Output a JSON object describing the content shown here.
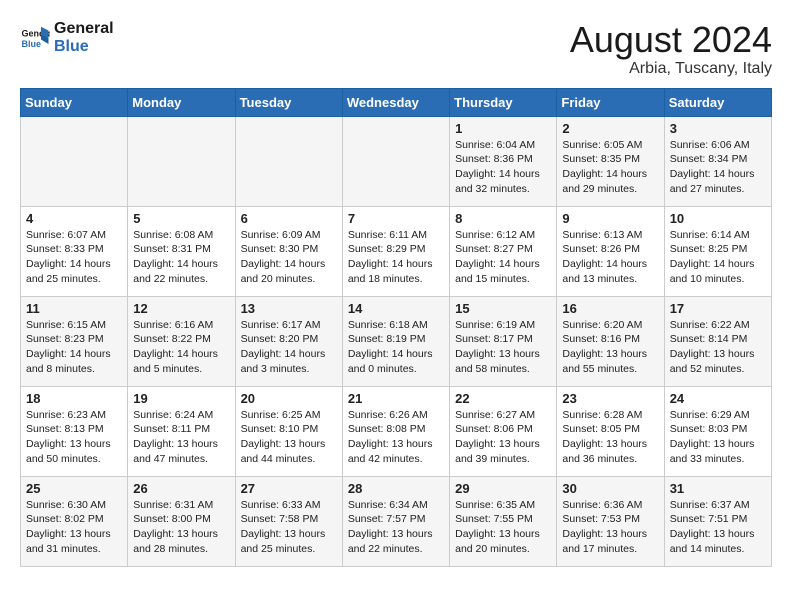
{
  "header": {
    "logo_line1": "General",
    "logo_line2": "Blue",
    "month_year": "August 2024",
    "location": "Arbia, Tuscany, Italy"
  },
  "weekdays": [
    "Sunday",
    "Monday",
    "Tuesday",
    "Wednesday",
    "Thursday",
    "Friday",
    "Saturday"
  ],
  "weeks": [
    [
      {
        "day": "",
        "info": ""
      },
      {
        "day": "",
        "info": ""
      },
      {
        "day": "",
        "info": ""
      },
      {
        "day": "",
        "info": ""
      },
      {
        "day": "1",
        "info": "Sunrise: 6:04 AM\nSunset: 8:36 PM\nDaylight: 14 hours\nand 32 minutes."
      },
      {
        "day": "2",
        "info": "Sunrise: 6:05 AM\nSunset: 8:35 PM\nDaylight: 14 hours\nand 29 minutes."
      },
      {
        "day": "3",
        "info": "Sunrise: 6:06 AM\nSunset: 8:34 PM\nDaylight: 14 hours\nand 27 minutes."
      }
    ],
    [
      {
        "day": "4",
        "info": "Sunrise: 6:07 AM\nSunset: 8:33 PM\nDaylight: 14 hours\nand 25 minutes."
      },
      {
        "day": "5",
        "info": "Sunrise: 6:08 AM\nSunset: 8:31 PM\nDaylight: 14 hours\nand 22 minutes."
      },
      {
        "day": "6",
        "info": "Sunrise: 6:09 AM\nSunset: 8:30 PM\nDaylight: 14 hours\nand 20 minutes."
      },
      {
        "day": "7",
        "info": "Sunrise: 6:11 AM\nSunset: 8:29 PM\nDaylight: 14 hours\nand 18 minutes."
      },
      {
        "day": "8",
        "info": "Sunrise: 6:12 AM\nSunset: 8:27 PM\nDaylight: 14 hours\nand 15 minutes."
      },
      {
        "day": "9",
        "info": "Sunrise: 6:13 AM\nSunset: 8:26 PM\nDaylight: 14 hours\nand 13 minutes."
      },
      {
        "day": "10",
        "info": "Sunrise: 6:14 AM\nSunset: 8:25 PM\nDaylight: 14 hours\nand 10 minutes."
      }
    ],
    [
      {
        "day": "11",
        "info": "Sunrise: 6:15 AM\nSunset: 8:23 PM\nDaylight: 14 hours\nand 8 minutes."
      },
      {
        "day": "12",
        "info": "Sunrise: 6:16 AM\nSunset: 8:22 PM\nDaylight: 14 hours\nand 5 minutes."
      },
      {
        "day": "13",
        "info": "Sunrise: 6:17 AM\nSunset: 8:20 PM\nDaylight: 14 hours\nand 3 minutes."
      },
      {
        "day": "14",
        "info": "Sunrise: 6:18 AM\nSunset: 8:19 PM\nDaylight: 14 hours\nand 0 minutes."
      },
      {
        "day": "15",
        "info": "Sunrise: 6:19 AM\nSunset: 8:17 PM\nDaylight: 13 hours\nand 58 minutes."
      },
      {
        "day": "16",
        "info": "Sunrise: 6:20 AM\nSunset: 8:16 PM\nDaylight: 13 hours\nand 55 minutes."
      },
      {
        "day": "17",
        "info": "Sunrise: 6:22 AM\nSunset: 8:14 PM\nDaylight: 13 hours\nand 52 minutes."
      }
    ],
    [
      {
        "day": "18",
        "info": "Sunrise: 6:23 AM\nSunset: 8:13 PM\nDaylight: 13 hours\nand 50 minutes."
      },
      {
        "day": "19",
        "info": "Sunrise: 6:24 AM\nSunset: 8:11 PM\nDaylight: 13 hours\nand 47 minutes."
      },
      {
        "day": "20",
        "info": "Sunrise: 6:25 AM\nSunset: 8:10 PM\nDaylight: 13 hours\nand 44 minutes."
      },
      {
        "day": "21",
        "info": "Sunrise: 6:26 AM\nSunset: 8:08 PM\nDaylight: 13 hours\nand 42 minutes."
      },
      {
        "day": "22",
        "info": "Sunrise: 6:27 AM\nSunset: 8:06 PM\nDaylight: 13 hours\nand 39 minutes."
      },
      {
        "day": "23",
        "info": "Sunrise: 6:28 AM\nSunset: 8:05 PM\nDaylight: 13 hours\nand 36 minutes."
      },
      {
        "day": "24",
        "info": "Sunrise: 6:29 AM\nSunset: 8:03 PM\nDaylight: 13 hours\nand 33 minutes."
      }
    ],
    [
      {
        "day": "25",
        "info": "Sunrise: 6:30 AM\nSunset: 8:02 PM\nDaylight: 13 hours\nand 31 minutes."
      },
      {
        "day": "26",
        "info": "Sunrise: 6:31 AM\nSunset: 8:00 PM\nDaylight: 13 hours\nand 28 minutes."
      },
      {
        "day": "27",
        "info": "Sunrise: 6:33 AM\nSunset: 7:58 PM\nDaylight: 13 hours\nand 25 minutes."
      },
      {
        "day": "28",
        "info": "Sunrise: 6:34 AM\nSunset: 7:57 PM\nDaylight: 13 hours\nand 22 minutes."
      },
      {
        "day": "29",
        "info": "Sunrise: 6:35 AM\nSunset: 7:55 PM\nDaylight: 13 hours\nand 20 minutes."
      },
      {
        "day": "30",
        "info": "Sunrise: 6:36 AM\nSunset: 7:53 PM\nDaylight: 13 hours\nand 17 minutes."
      },
      {
        "day": "31",
        "info": "Sunrise: 6:37 AM\nSunset: 7:51 PM\nDaylight: 13 hours\nand 14 minutes."
      }
    ]
  ]
}
